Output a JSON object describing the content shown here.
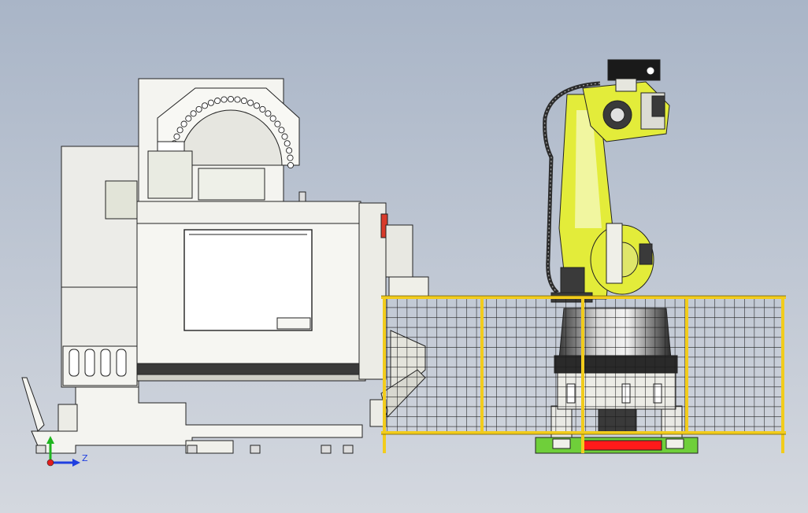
{
  "viewport": {
    "background_top": "#a9b5c7",
    "background_bottom": "#d4d8df"
  },
  "colors": {
    "fence_yellow": "#f2cc1c",
    "fence_mesh": "#1a1a1a",
    "robot_yellow": "#e3ec3a",
    "robot_yellow_light": "#f1f6a0",
    "machine_body": "#f2f2ee",
    "machine_outline": "#222222",
    "base_green": "#6fcf3a",
    "base_red": "#ff1a1a",
    "axis_x": "#e21d1d",
    "axis_y": "#1fb51f",
    "axis_z": "#1f3fe0"
  },
  "triad": {
    "z_label": "Z"
  },
  "icons": {
    "triad": "coordinate-triad-icon"
  }
}
